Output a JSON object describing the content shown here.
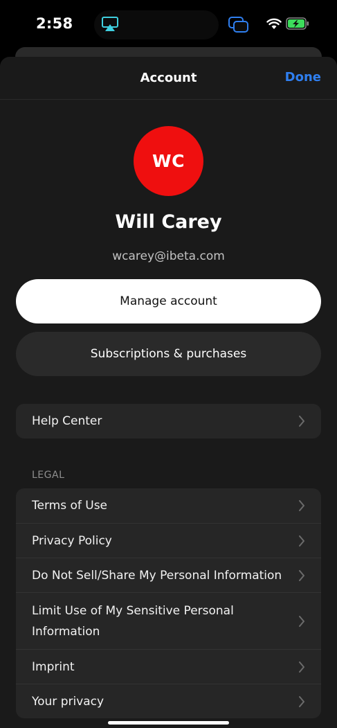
{
  "status_bar": {
    "time": "2:58",
    "icons": [
      "airplay-icon",
      "screen-mirror-icon",
      "wifi-icon",
      "battery-charging-icon"
    ],
    "colors": {
      "airplay": "#3fd0e0",
      "mirror": "#2f7ff0",
      "battery": "#3ddc5c"
    }
  },
  "nav": {
    "title": "Account",
    "done_label": "Done",
    "done_color": "#2f7ff0"
  },
  "profile": {
    "initials": "WC",
    "avatar_color": "#ef0f0f",
    "name": "Will Carey",
    "email": "wcarey@ibeta.com"
  },
  "buttons": {
    "manage": "Manage account",
    "subscriptions": "Subscriptions & purchases"
  },
  "help": {
    "label": "Help Center"
  },
  "legal": {
    "header": "LEGAL",
    "items": [
      {
        "label": "Terms of Use"
      },
      {
        "label": "Privacy Policy"
      },
      {
        "label": "Do Not Sell/Share My Personal Information"
      },
      {
        "label": "Limit Use of My Sensitive Personal Information"
      },
      {
        "label": "Imprint"
      },
      {
        "label": "Your privacy"
      }
    ]
  }
}
